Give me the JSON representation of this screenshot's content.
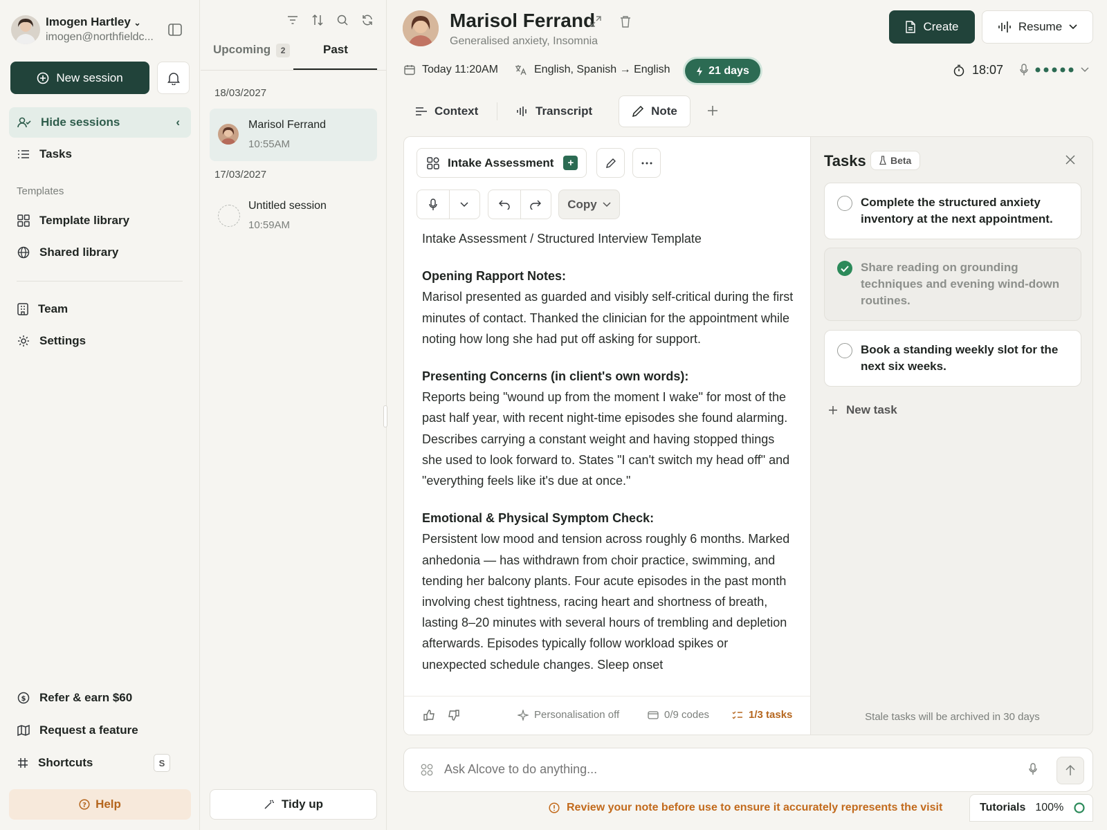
{
  "user": {
    "name": "Imogen Hartley",
    "email": "imogen@northfieldc..."
  },
  "sidebar": {
    "new_session": "New session",
    "items": [
      {
        "label": "Hide sessions"
      },
      {
        "label": "Tasks"
      }
    ],
    "templates_label": "Templates",
    "template_items": [
      {
        "label": "Template library"
      },
      {
        "label": "Shared library"
      }
    ],
    "org_items": [
      {
        "label": "Team"
      },
      {
        "label": "Settings"
      }
    ],
    "bottom_items": [
      {
        "label": "Refer & earn $60"
      },
      {
        "label": "Request a feature"
      },
      {
        "label": "Shortcuts",
        "key": "S"
      }
    ],
    "help": "Help"
  },
  "sessions": {
    "tab_upcoming": "Upcoming",
    "upcoming_count": "2",
    "tab_past": "Past",
    "groups": [
      {
        "date": "18/03/2027",
        "name": "Marisol Ferrand",
        "time": "10:55AM"
      },
      {
        "date": "17/03/2027",
        "name": "Untitled session",
        "time": "10:59AM"
      }
    ],
    "tidy_up": "Tidy up"
  },
  "patient": {
    "name": "Marisol Ferrand",
    "conditions": "Generalised anxiety, Insomnia",
    "date": "Today 11:20AM",
    "languages": "English, Spanish → English",
    "days_badge": "21 days",
    "timer": "18:07"
  },
  "header": {
    "create": "Create",
    "resume": "Resume"
  },
  "tabs": [
    {
      "label": "Context"
    },
    {
      "label": "Transcript"
    },
    {
      "label": "Note"
    }
  ],
  "note": {
    "template": "Intake Assessment",
    "copy": "Copy",
    "title_line": "Intake Assessment / Structured Interview Template",
    "sections": [
      {
        "heading": "Opening Rapport Notes:",
        "body": "Marisol presented as guarded and visibly self-critical during the first minutes of contact. Thanked the clinician for the appointment while noting how long she had put off asking for support."
      },
      {
        "heading": "Presenting Concerns (in client's own words):",
        "body": "Reports being \"wound up from the moment I wake\" for most of the past half year, with recent night-time episodes she found alarming. Describes carrying a constant weight and having stopped things she used to look forward to. States \"I can't switch my head off\" and \"everything feels like it's due at once.\""
      },
      {
        "heading": "Emotional & Physical Symptom Check:",
        "body": "Persistent low mood and tension across roughly 6 months. Marked anhedonia — has withdrawn from choir practice, swimming, and tending her balcony plants. Four acute episodes in the past month involving chest tightness, racing heart and shortness of breath, lasting 8–20 minutes with several hours of trembling and depletion afterwards. Episodes typically follow workload spikes or unexpected schedule changes. Sleep onset"
      }
    ],
    "footer": {
      "personalisation": "Personalisation off",
      "codes": "0/9 codes",
      "tasks": "1/3 tasks"
    }
  },
  "tasks": {
    "title": "Tasks",
    "beta": "Beta",
    "items": [
      {
        "text": "Complete the structured anxiety inventory at the next appointment.",
        "done": false
      },
      {
        "text": "Share reading on grounding techniques and evening wind-down routines.",
        "done": true
      },
      {
        "text": "Book a standing weekly slot for the next six weeks.",
        "done": false
      }
    ],
    "new_task": "New task",
    "stale_note": "Stale tasks will be archived in 30 days"
  },
  "ask": {
    "placeholder": "Ask Alcove to do anything..."
  },
  "warning": "Review your note before use to ensure it accurately represents the visit",
  "tutorials": {
    "label": "Tutorials",
    "progress": "100%"
  },
  "colors": {
    "brand": "#21433a",
    "accent_green": "#2c6b53",
    "warning": "#c26a1c"
  }
}
